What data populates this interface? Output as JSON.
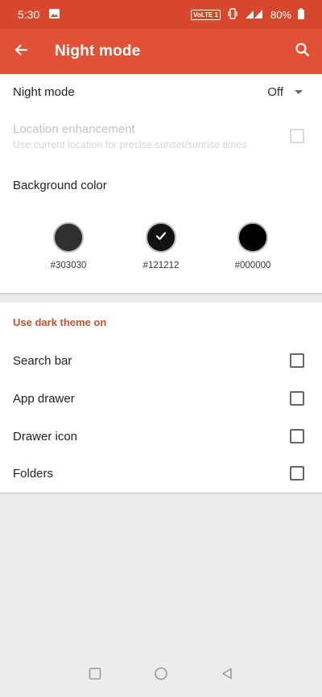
{
  "status_bar": {
    "time": "5:30",
    "network_badge": "VoLTE 1",
    "battery_percent": "80%",
    "icons": [
      "image-icon",
      "vibrate-icon",
      "signal-icon",
      "battery-icon"
    ]
  },
  "app_bar": {
    "title": "Night mode",
    "back_icon": "arrow-left-icon",
    "search_icon": "search-icon",
    "color": "#e25133"
  },
  "night_mode": {
    "label": "Night mode",
    "value": "Off"
  },
  "location": {
    "title": "Location enhancement",
    "subtitle": "Use current location for precise sunset/sunrise times",
    "checked": false,
    "enabled": false
  },
  "background": {
    "label": "Background color",
    "swatches": [
      {
        "label": "#303030",
        "color": "#303030",
        "selected": false
      },
      {
        "label": "#121212",
        "color": "#121212",
        "selected": true
      },
      {
        "label": "#000000",
        "color": "#000000",
        "selected": false
      }
    ]
  },
  "dark_theme": {
    "header": "Use dark theme on",
    "items": [
      {
        "label": "Search bar",
        "checked": false
      },
      {
        "label": "App drawer",
        "checked": false
      },
      {
        "label": "Drawer icon",
        "checked": false
      },
      {
        "label": "Folders",
        "checked": false
      }
    ]
  },
  "nav_bar": {
    "icons": [
      "recents-square-icon",
      "home-circle-icon",
      "back-triangle-icon"
    ]
  },
  "colors": {
    "accent": "#c8512f",
    "status_bar": "#d8472b"
  }
}
